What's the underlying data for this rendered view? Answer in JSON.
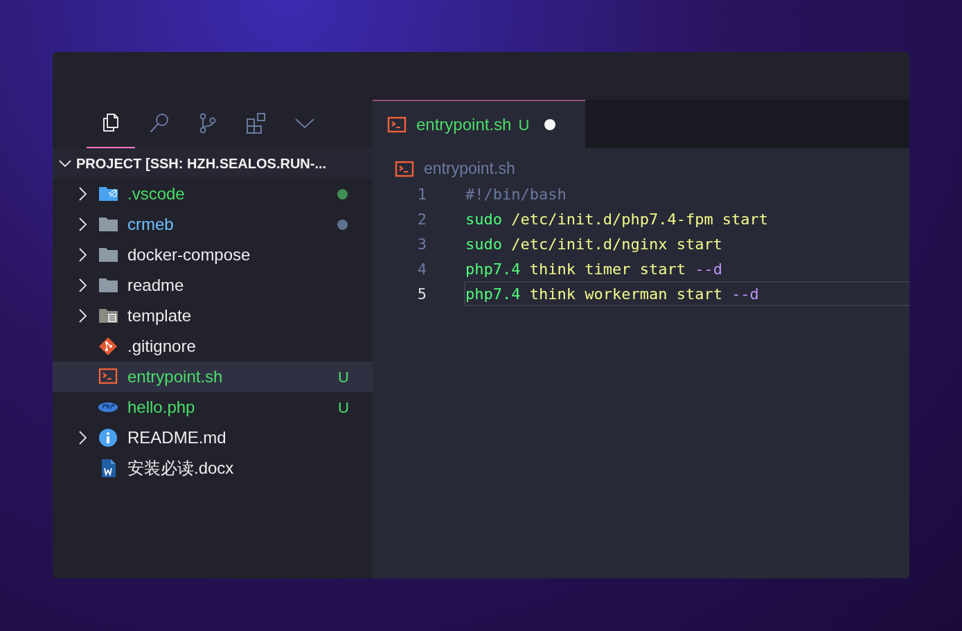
{
  "activity_bar": [
    {
      "kind": "files",
      "selected": true
    },
    {
      "kind": "search",
      "selected": false
    },
    {
      "kind": "source-control",
      "selected": false
    },
    {
      "kind": "extensions",
      "selected": false
    },
    {
      "kind": "more",
      "selected": false
    }
  ],
  "explorer": {
    "title": "PROJECT [SSH: HZH.SEALOS.RUN-...",
    "expanded": true,
    "items": [
      {
        "name": ".vscode",
        "kind": "vscode-folder",
        "expandable": true,
        "color": "#4ade6a",
        "decoration": {
          "kind": "dot",
          "color": "#3f8f55"
        },
        "selected": false
      },
      {
        "name": "crmeb",
        "kind": "folder",
        "expandable": true,
        "color": "#6cc2ff",
        "decoration": {
          "kind": "dot",
          "color": "#5f7391"
        },
        "selected": false
      },
      {
        "name": "docker-compose",
        "kind": "folder",
        "expandable": true,
        "color": "#eeeeee",
        "selected": false
      },
      {
        "name": "readme",
        "kind": "folder",
        "expandable": true,
        "color": "#eeeeee",
        "selected": false
      },
      {
        "name": "template",
        "kind": "template-folder",
        "expandable": true,
        "color": "#eeeeee",
        "selected": false
      },
      {
        "name": ".gitignore",
        "kind": "git",
        "expandable": false,
        "color": "#eeeeee",
        "selected": false
      },
      {
        "name": "entrypoint.sh",
        "kind": "shell",
        "expandable": false,
        "color": "#4ade6a",
        "decoration": {
          "kind": "badge",
          "text": "U"
        },
        "selected": true
      },
      {
        "name": "hello.php",
        "kind": "php",
        "expandable": false,
        "color": "#4ade6a",
        "decoration": {
          "kind": "badge",
          "text": "U"
        },
        "selected": false
      },
      {
        "name": "README.md",
        "kind": "info",
        "expandable": true,
        "color": "#eeeeee",
        "selected": false
      },
      {
        "name": "安装必读.docx",
        "kind": "word",
        "expandable": false,
        "color": "#eeeeee",
        "selected": false
      }
    ]
  },
  "tabs": [
    {
      "label": "entrypoint.sh",
      "kind": "shell",
      "badge": "U",
      "dirty": true,
      "selected": true
    }
  ],
  "breadcrumb": {
    "kind": "shell",
    "text": "entrypoint.sh"
  },
  "code": [
    {
      "number": "1",
      "selected": false,
      "tokens": [
        {
          "text": "#!/bin/bash",
          "kind": "comment"
        }
      ]
    },
    {
      "number": "2",
      "selected": false,
      "tokens": [
        {
          "text": "sudo",
          "kind": "command"
        },
        {
          "text": " /etc/init.d/php7.4-fpm start",
          "kind": "string"
        }
      ]
    },
    {
      "number": "3",
      "selected": false,
      "tokens": [
        {
          "text": "sudo",
          "kind": "command"
        },
        {
          "text": " /etc/init.d/nginx start",
          "kind": "string"
        }
      ]
    },
    {
      "number": "4",
      "selected": false,
      "tokens": [
        {
          "text": "php7.4",
          "kind": "command"
        },
        {
          "text": " think timer start ",
          "kind": "string"
        },
        {
          "text": "--d",
          "kind": "flag"
        }
      ]
    },
    {
      "number": "5",
      "selected": true,
      "tokens": [
        {
          "text": "php7.4",
          "kind": "command"
        },
        {
          "text": " think workerman start ",
          "kind": "string"
        },
        {
          "text": "--d",
          "kind": "flag"
        }
      ]
    }
  ]
}
